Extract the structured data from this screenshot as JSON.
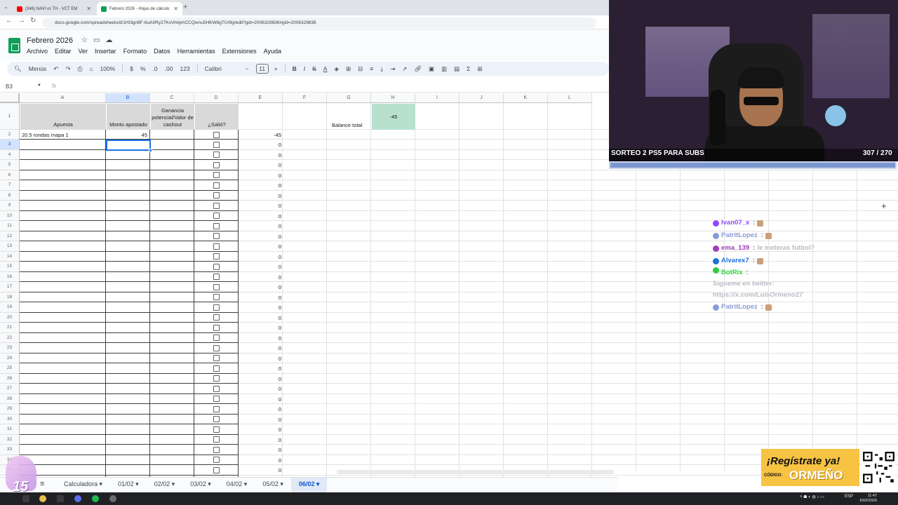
{
  "browser": {
    "tabs": [
      {
        "title": "(346) NAVI vs TH - VCT EM",
        "active": false
      },
      {
        "title": "Febrero 2026 - Hojas de cálculo",
        "active": true
      }
    ],
    "url": "docs.google.com/spreadsheets/d/1HI3gri8F-6uAIIRy27KxVrklymCCQwnu5HKW8gTUr9g/edit?gid=2006329836#gid=2006329836"
  },
  "sheets": {
    "doc_title": "Febrero 2026",
    "menu": [
      "Archivo",
      "Editar",
      "Ver",
      "Insertar",
      "Formato",
      "Datos",
      "Herramientas",
      "Extensiones",
      "Ayuda"
    ],
    "toolbar": {
      "menus_label": "Menús",
      "zoom": "100%",
      "currency": "$",
      "percent": "%",
      "dec_dec": ".0",
      "dec_inc": ".00",
      "format_123": "123",
      "font": "Calibri",
      "font_size": "11"
    },
    "name_box": "B3",
    "fx": "fx",
    "columns": [
      "A",
      "B",
      "C",
      "D",
      "E",
      "F",
      "G",
      "H",
      "I",
      "J",
      "K",
      "L"
    ],
    "headers": {
      "a": "Apuesta",
      "b": "Monto apostado",
      "c": "Ganancia potencial/Valor de cashout",
      "d": "¿Salió?"
    },
    "row2": {
      "a": "20.5 rondas mapa 1",
      "b": "45",
      "e": "-45"
    },
    "balance_label": "Balance total",
    "balance_value": "-45",
    "zero": "0",
    "sheet_tabs": [
      "Calculadora",
      "01/02",
      "02/02",
      "03/02",
      "04/02",
      "05/02",
      "06/02"
    ],
    "active_sheet": "06/02"
  },
  "taskbar": {
    "language": "ESP",
    "time": "11:47",
    "date": "6/02/2026"
  },
  "stream": {
    "giveaway": "SORTEO 2 PS5 PARA SUBS",
    "goal": "307 / 270",
    "goal_fraction": 1.0,
    "chat": [
      {
        "user": "Ivan07_x",
        "text": "",
        "color": "#9147ff"
      },
      {
        "user": "PatritLopez",
        "text": "",
        "color": "#8a9bd6"
      },
      {
        "user": "ema_139",
        "text": "le meteras futbol?",
        "color": "#a23dbb"
      },
      {
        "user": "Alvarex7",
        "text": "",
        "color": "#1e6fd9"
      },
      {
        "user": "BotRix",
        "text": "Sigueme en twitter: https://x.com/LuisOrmeno27",
        "color": "#2ecc40"
      },
      {
        "user": "PatritLopez",
        "text": "",
        "color": "#8a9bd6"
      }
    ],
    "promo_title": "¡Regístrate ya!",
    "promo_code_label": "CÓDIGO:",
    "promo_code": "ORMEÑO",
    "sub_count": "15"
  }
}
